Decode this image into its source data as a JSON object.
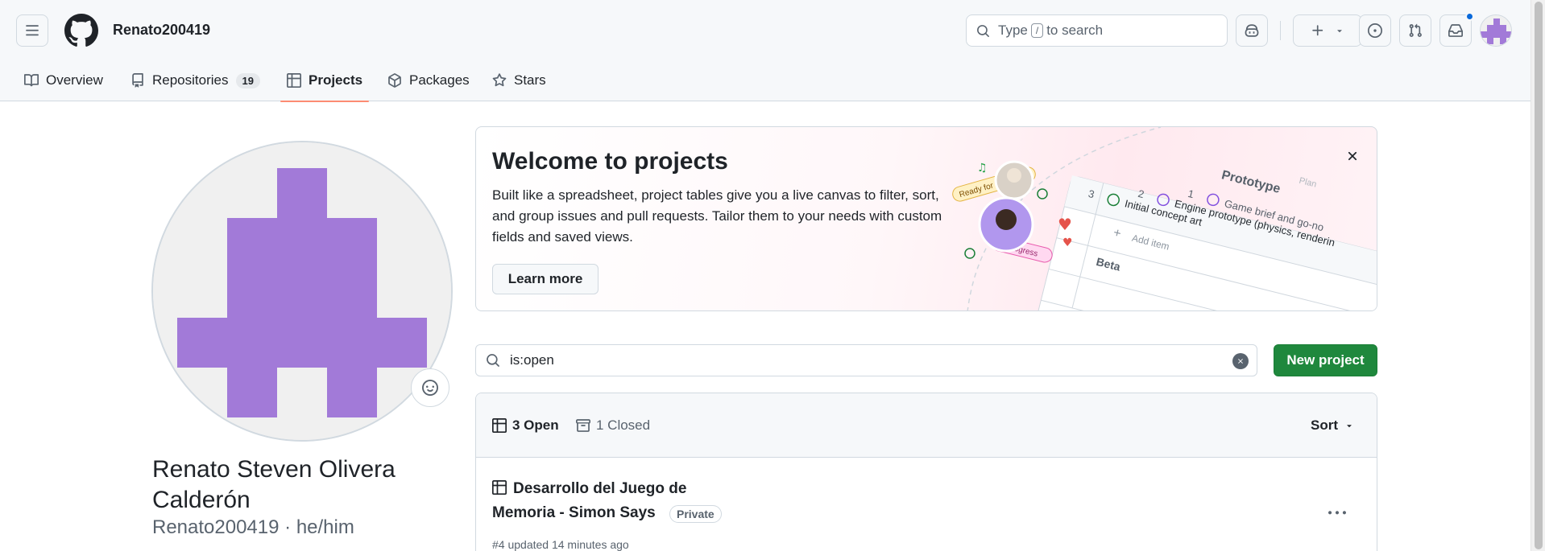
{
  "header": {
    "username": "Renato200419",
    "search": {
      "pre": "Type",
      "key": "/",
      "post": "to search"
    }
  },
  "tabs": [
    {
      "label": "Overview",
      "icon": "book-icon"
    },
    {
      "label": "Repositories",
      "icon": "repo-icon",
      "count": "19"
    },
    {
      "label": "Projects",
      "icon": "table-icon",
      "active": true
    },
    {
      "label": "Packages",
      "icon": "package-icon"
    },
    {
      "label": "Stars",
      "icon": "star-icon"
    }
  ],
  "profile": {
    "full_name": "Renato Steven Olivera Calderón",
    "login": "Renato200419",
    "pronouns": "he/him",
    "avatar_color": "#a27ad8"
  },
  "banner": {
    "title": "Welcome to projects",
    "body": "Built like a spreadsheet, project tables give you a live canvas to filter, sort, and group issues and pull requests. Tailor them to your needs with custom fields and saved views.",
    "button": "Learn more",
    "illustration": {
      "ready_label": "Ready for review",
      "progress_label": "In progress",
      "group_label": "Prototype",
      "rows": [
        {
          "num": "1",
          "text": "Game brief and go-no"
        },
        {
          "num": "2",
          "text": "Engine prototype (physics, renderin"
        },
        {
          "num": "3",
          "text": "Initial concept art"
        }
      ],
      "add_item": "Add item",
      "plan_label": "Plan",
      "beta_label": "Beta"
    }
  },
  "filter": {
    "value": "is:open",
    "new_button": "New project"
  },
  "list": {
    "open_label": "3 Open",
    "closed_label": "1 Closed",
    "sort_label": "Sort",
    "projects": [
      {
        "title": "Desarrollo del Juego de Memoria - Simon Says",
        "visibility": "Private",
        "meta": "#4 updated 14 minutes ago"
      }
    ]
  },
  "colors": {
    "primary_button": "#1f883d",
    "active_tab_underline": "#fd8c73",
    "notification_dot": "#0969da"
  }
}
